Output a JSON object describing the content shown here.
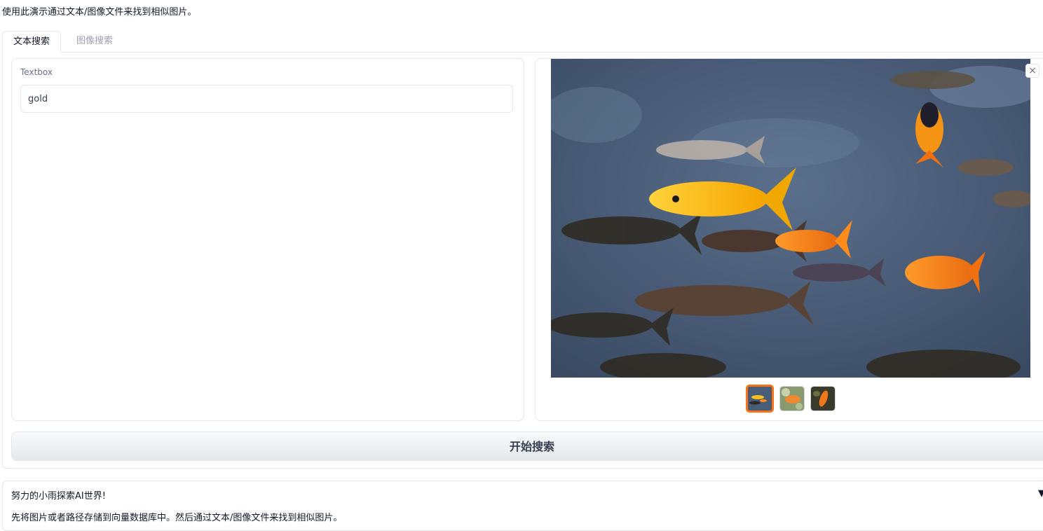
{
  "intro_text": "使用此演示通过文本/图像文件来找到相似图片。",
  "tabs": [
    {
      "label": "文本搜索",
      "active": true
    },
    {
      "label": "图像搜索",
      "active": false
    }
  ],
  "textbox": {
    "label": "Textbox",
    "value": "gold"
  },
  "gallery": {
    "close_icon": "×",
    "selected_index": 0,
    "thumbnail_count": 3
  },
  "search_button": {
    "label": "开始搜索"
  },
  "accordion": {
    "title": "努力的小雨探索AI世界!",
    "arrow": "▼",
    "body": "先将图片或者路径存储到向量数据库中。然后通过文本/图像文件来找到相似图片。"
  },
  "colors": {
    "accent": "#f97316",
    "border": "#e5e7eb"
  }
}
